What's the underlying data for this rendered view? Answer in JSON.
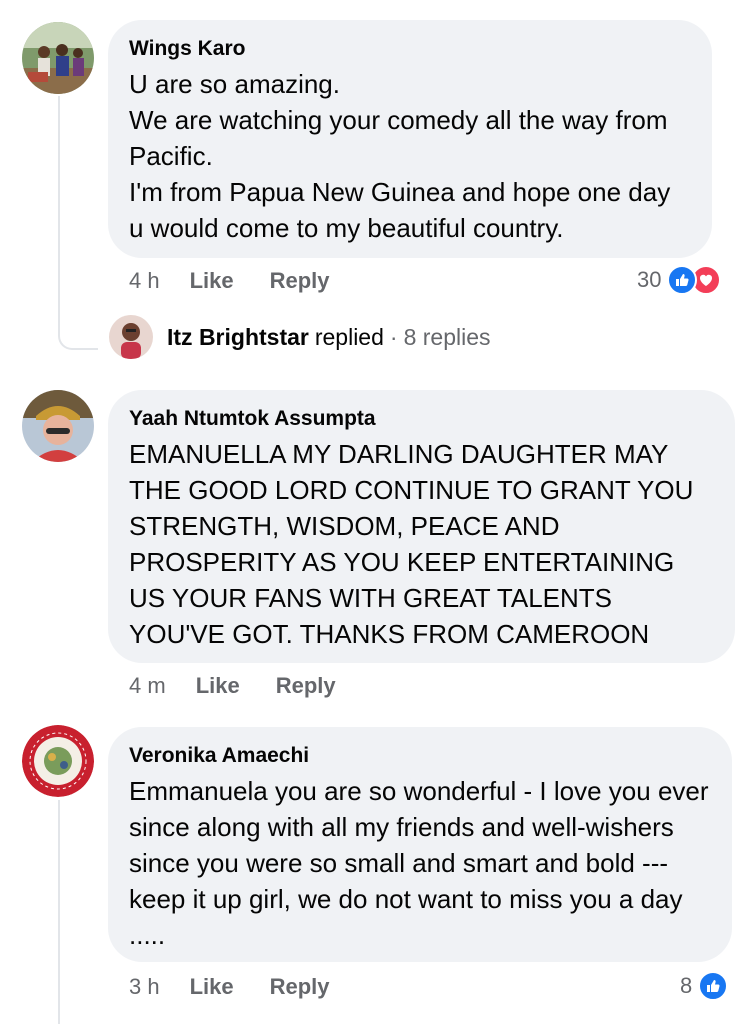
{
  "comments": [
    {
      "author": "Wings Karo",
      "text": "U are so amazing.\nWe are watching your comedy all the way from Pacific.\nI'm from Papua New Guinea and hope one day u would come to my beautiful country.",
      "time": "4 h",
      "like_label": "Like",
      "reply_label": "Reply",
      "reaction_count": "30",
      "reactions": [
        "like-icon",
        "love-icon"
      ],
      "reply_summary": {
        "name": "Itz Brightstar",
        "verb": "replied",
        "separator": "·",
        "count_text": "8 replies"
      }
    },
    {
      "author": "Yaah Ntumtok Assumpta",
      "text": "EMANUELLA MY DARLING DAUGHTER MAY THE GOOD LORD CONTINUE TO GRANT YOU STRENGTH, WISDOM, PEACE AND PROSPERITY AS YOU KEEP ENTERTAINING US YOUR FANS WITH GREAT TALENTS YOU'VE GOT. THANKS FROM CAMEROON",
      "time": "4 m",
      "like_label": "Like",
      "reply_label": "Reply"
    },
    {
      "author": "Veronika Amaechi",
      "text": "Emmanuela you are so wonderful - I love you ever since along with all my friends and well-wishers since you were so small and smart and bold --- keep it up girl, we do not want to miss you a day .....",
      "time": "3 h",
      "like_label": "Like",
      "reply_label": "Reply",
      "reaction_count": "8",
      "reactions": [
        "like-icon"
      ]
    }
  ],
  "colors": {
    "bubble": "#f0f2f5",
    "text": "#050505",
    "secondary": "#65676b",
    "like_blue": "#1877f2",
    "love_red": "#f33e58"
  }
}
